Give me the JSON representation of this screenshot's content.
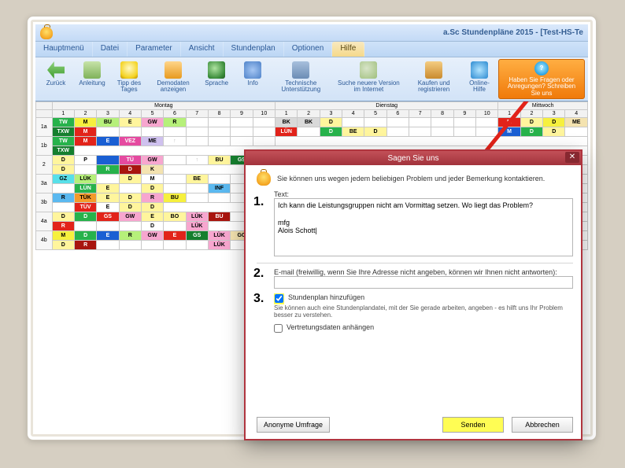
{
  "app": {
    "title": "a.Sc Stundenpläne 2015 - [Test-HS-Te"
  },
  "menu": {
    "items": [
      "Hauptmenü",
      "Datei",
      "Parameter",
      "Ansicht",
      "Stundenplan",
      "Optionen",
      "Hilfe"
    ],
    "active_index": 6
  },
  "toolbar": {
    "items": [
      {
        "label": "Zurück",
        "icon": "ic-back"
      },
      {
        "label": "Anleitung",
        "icon": "ic-book"
      },
      {
        "label": "Tipp des Tages",
        "icon": "ic-light"
      },
      {
        "label": "Demodaten anzeigen",
        "icon": "ic-demo"
      },
      {
        "label": "Sprache",
        "icon": "ic-globe2"
      },
      {
        "label": "Info",
        "icon": "ic-info"
      },
      {
        "label": "Technische Unterstützung",
        "icon": "ic-support"
      },
      {
        "label": "Suche neuere Version im Internet",
        "icon": "ic-find"
      },
      {
        "label": "Kaufen und registrieren",
        "icon": "ic-box"
      },
      {
        "label": "Online-Hilfe",
        "icon": "ic-help"
      }
    ],
    "cta": {
      "line1": "Haben Sie Fragen oder",
      "line2": "Anregungen? Schreiben Sie uns"
    }
  },
  "timetable": {
    "day_headers": [
      "Montag",
      "Dienstag",
      "Mittwoch"
    ],
    "period_numbers": [
      "1",
      "2",
      "3",
      "4",
      "5",
      "6",
      "7",
      "8",
      "9",
      "10"
    ],
    "row_labels": [
      "1a",
      "1b",
      "2",
      "3a",
      "3b",
      "4a",
      "4b"
    ],
    "cells": {
      "r1": [
        "TW",
        "M",
        "BU",
        "E",
        "GW",
        "R",
        "",
        "",
        "",
        "",
        "BK",
        "BK",
        "D",
        "",
        "",
        "",
        "",
        "",
        "",
        "",
        "M",
        "D",
        "D",
        "ME"
      ],
      "r1b": [
        "TXW",
        "M",
        "",
        "",
        "",
        "",
        "",
        "",
        "",
        "",
        "LÜN",
        "",
        "D",
        "BE",
        "D",
        "",
        "",
        "",
        "",
        "",
        "M",
        "D",
        "D",
        ""
      ],
      "r2": [
        "TW",
        "M",
        "E",
        "VEZ",
        "ME",
        "↑",
        "",
        "",
        "",
        "",
        "",
        "",
        "",
        "",
        "",
        "",
        "",
        "",
        "",
        "",
        "",
        "",
        "",
        ""
      ],
      "r2b": [
        "TXW",
        "",
        "",
        "",
        "",
        "",
        "",
        "",
        "",
        "",
        "",
        "",
        "",
        "",
        "",
        "",
        "",
        "",
        "",
        "",
        "",
        "",
        "",
        ""
      ],
      "r3": [
        "D",
        "P",
        "",
        "TÜ",
        "GW",
        "",
        "↑",
        "BU",
        "GS",
        "",
        "",
        "",
        "",
        "",
        "",
        "",
        "",
        "",
        "",
        "",
        "",
        "",
        "",
        ""
      ],
      "r3b": [
        "D",
        "",
        "R",
        "D",
        "K",
        "",
        "",
        "",
        "",
        "",
        "",
        "",
        "",
        "",
        "",
        "",
        "",
        "",
        "",
        "",
        "",
        "",
        "",
        ""
      ],
      "r4": [
        "GZ",
        "LÜK",
        "",
        "D",
        "M",
        "",
        "BE",
        "",
        "",
        "",
        "",
        "",
        "",
        "",
        "",
        "",
        "",
        "",
        "",
        "",
        "",
        "",
        "",
        ""
      ],
      "r4b": [
        "",
        "LÜN",
        "E",
        "",
        "D",
        "",
        "",
        "INF",
        "",
        "",
        "",
        "",
        "",
        "",
        "",
        "",
        "",
        "",
        "",
        "",
        "",
        "",
        "",
        ""
      ],
      "r5": [
        "R",
        "TÜK",
        "E",
        "D",
        "R",
        "BU",
        "",
        "",
        "",
        "",
        "",
        "",
        "",
        "",
        "",
        "",
        "",
        "",
        "",
        "",
        "",
        "",
        "",
        ""
      ],
      "r5b": [
        "",
        "TÜV",
        "E",
        "D",
        "D",
        "",
        "",
        "",
        "",
        "",
        "",
        "",
        "",
        "",
        "",
        "",
        "",
        "",
        "",
        "",
        "",
        "",
        "",
        ""
      ],
      "r6": [
        "D",
        "D",
        "GS",
        "GW",
        "E",
        "BO",
        "LÜK",
        "BU",
        "",
        "",
        "",
        "",
        "",
        "",
        "",
        "",
        "",
        "",
        "",
        "",
        "",
        "",
        "",
        ""
      ],
      "r6b": [
        "R",
        "",
        "",
        "",
        "D",
        "",
        "LÜK",
        "",
        "",
        "",
        "",
        "",
        "",
        "",
        "",
        "",
        "",
        "",
        "",
        "",
        "",
        "",
        "",
        ""
      ],
      "r7": [
        "M",
        "D",
        "E",
        "R",
        "GW",
        "E",
        "GS",
        "LÜK",
        "GO",
        "",
        "",
        "",
        "",
        "",
        "",
        "",
        "",
        "",
        "",
        "",
        "",
        "",
        "",
        ""
      ],
      "r7b": [
        "D",
        "R",
        "",
        "",
        "",
        "",
        "",
        "LÜK",
        "",
        "",
        "",
        "",
        "",
        "",
        "",
        "",
        "",
        "",
        "",
        "",
        "",
        "",
        "",
        ""
      ]
    }
  },
  "dialog": {
    "title": "Sagen Sie uns",
    "lead": "Sie können uns wegen jedem beliebigen Problem und jeder Bemerkung kontaktieren.",
    "text_label": "Text:",
    "text_value": "Ich kann die Leistungsgruppen nicht am Vormittag setzen. Wo liegt das Problem?\n\nmfg\nAlois Schott|",
    "email_label": "E-mail (freiwillig, wenn Sie Ihre Adresse nicht angeben, können wir Ihnen nicht antworten):",
    "email_value": "",
    "attach_checkbox": "Stundenplan hinzufügen",
    "attach_hint": "Sie können auch eine Stundenplandatei, mit der Sie gerade arbeiten, angeben - es hilft uns Ihr Problem besser zu verstehen.",
    "subst_checkbox": "Vertretungsdaten anhängen",
    "btn_survey": "Anonyme Umfrage",
    "btn_send": "Senden",
    "btn_cancel": "Abbrechen",
    "step1": "1.",
    "step2": "2.",
    "step3": "3."
  }
}
